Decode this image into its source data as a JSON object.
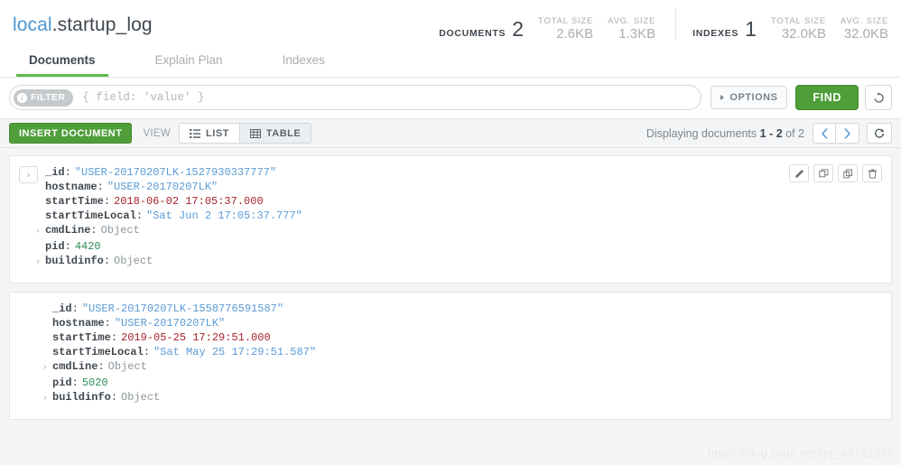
{
  "header": {
    "namespace": {
      "database": "local",
      "separator": ".",
      "collection": "startup_log"
    },
    "stats": {
      "documents": {
        "label": "DOCUMENTS",
        "value": "2",
        "total_size_label": "TOTAL SIZE",
        "total_size": "2.6KB",
        "avg_size_label": "AVG. SIZE",
        "avg_size": "1.3KB"
      },
      "indexes": {
        "label": "INDEXES",
        "value": "1",
        "total_size_label": "TOTAL SIZE",
        "total_size": "32.0KB",
        "avg_size_label": "AVG. SIZE",
        "avg_size": "32.0KB"
      }
    }
  },
  "tabs": [
    {
      "label": "Documents",
      "active": true
    },
    {
      "label": "Explain Plan",
      "active": false
    },
    {
      "label": "Indexes",
      "active": false
    }
  ],
  "query_bar": {
    "filter_badge": "FILTER",
    "filter_placeholder": "{ field: 'value' }",
    "filter_value": "",
    "options_label": "OPTIONS",
    "find_label": "FIND",
    "reset_title": "Reset"
  },
  "toolbar": {
    "insert_label": "INSERT DOCUMENT",
    "view_label": "VIEW",
    "view_modes": [
      {
        "label": "LIST",
        "active": true
      },
      {
        "label": "TABLE",
        "active": false
      }
    ],
    "pager": {
      "prefix": "Displaying documents",
      "range": "1 - 2",
      "suffix": "of 2"
    }
  },
  "documents": [
    {
      "actions": [
        "edit-icon",
        "clone-icon",
        "copy-icon",
        "delete-icon"
      ],
      "expanded": false,
      "fields": [
        {
          "key": "_id",
          "value": "\"USER-20170207LK-1527930337777\"",
          "type": "string",
          "expandable": false
        },
        {
          "key": "hostname",
          "value": "\"USER-20170207LK\"",
          "type": "string",
          "expandable": false
        },
        {
          "key": "startTime",
          "value": "2018-06-02 17:05:37.000",
          "type": "date",
          "expandable": false
        },
        {
          "key": "startTimeLocal",
          "value": "\"Sat Jun 2 17:05:37.777\"",
          "type": "string",
          "expandable": false
        },
        {
          "key": "cmdLine",
          "value": "Object",
          "type": "object",
          "expandable": true
        },
        {
          "key": "pid",
          "value": "4420",
          "type": "number",
          "expandable": false
        },
        {
          "key": "buildinfo",
          "value": "Object",
          "type": "object",
          "expandable": true
        }
      ]
    },
    {
      "actions": [],
      "expanded": false,
      "fields": [
        {
          "key": "_id",
          "value": "\"USER-20170207LK-1558776591587\"",
          "type": "string",
          "expandable": false
        },
        {
          "key": "hostname",
          "value": "\"USER-20170207LK\"",
          "type": "string",
          "expandable": false
        },
        {
          "key": "startTime",
          "value": "2019-05-25 17:29:51.000",
          "type": "date",
          "expandable": false
        },
        {
          "key": "startTimeLocal",
          "value": "\"Sat May 25 17:29:51.587\"",
          "type": "string",
          "expandable": false
        },
        {
          "key": "cmdLine",
          "value": "Object",
          "type": "object",
          "expandable": true
        },
        {
          "key": "pid",
          "value": "5020",
          "type": "number",
          "expandable": false
        },
        {
          "key": "buildinfo",
          "value": "Object",
          "type": "object",
          "expandable": true
        }
      ]
    }
  ],
  "watermark": "https://blog.csdn.net/qq_43792385",
  "colors": {
    "accent_green": "#4f9e39",
    "link_blue": "#4e97d2",
    "string_blue": "#5b9bd5",
    "date_red": "#a8232b",
    "number_green": "#2e8b57",
    "page_bg": "#f4f5f6"
  }
}
